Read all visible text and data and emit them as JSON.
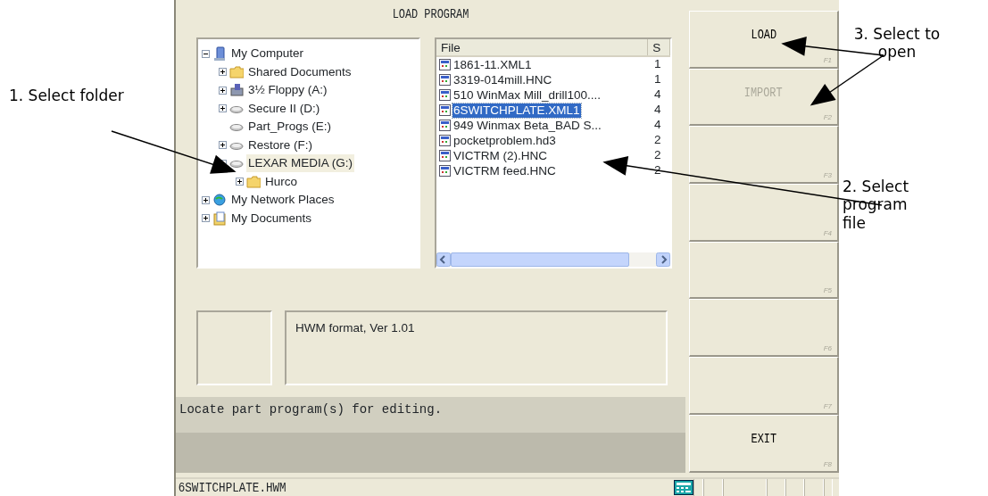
{
  "title": "LOAD PROGRAM",
  "folder_tree": [
    {
      "label": "My Computer",
      "kind": "computer",
      "expanded": true,
      "selected": false,
      "children": [
        {
          "label": "Shared Documents",
          "kind": "folder",
          "expanded": false,
          "selected": false
        },
        {
          "label": "3½ Floppy (A:)",
          "kind": "floppy",
          "expanded": false,
          "selected": false
        },
        {
          "label": "Secure II (D:)",
          "kind": "drive",
          "expanded": false,
          "selected": false
        },
        {
          "label": "Part_Progs (E:)",
          "kind": "drive",
          "selected": false
        },
        {
          "label": "Restore (F:)",
          "kind": "drive",
          "expanded": false,
          "selected": false
        },
        {
          "label": "LEXAR MEDIA (G:)",
          "kind": "drive",
          "expanded": true,
          "selected": true,
          "children": [
            {
              "label": "Hurco",
              "kind": "folder",
              "expanded": false,
              "selected": false
            }
          ]
        }
      ]
    },
    {
      "label": "My Network Places",
      "kind": "network",
      "expanded": false,
      "selected": false
    },
    {
      "label": "My Documents",
      "kind": "documents",
      "expanded": false,
      "selected": false
    }
  ],
  "file_list": {
    "columns": [
      "File",
      "S"
    ],
    "rows": [
      {
        "name": "1861-11.XML1",
        "column_2": "1",
        "selected": false
      },
      {
        "name": "3319-014mill.HNC",
        "column_2": "1",
        "selected": false
      },
      {
        "name": "510 WinMax Mill_drill100....",
        "column_2": "4",
        "selected": false
      },
      {
        "name": "6SWITCHPLATE.XML1",
        "column_2": "4",
        "selected": true
      },
      {
        "name": "949 Winmax Beta_BAD S...",
        "column_2": "4",
        "selected": false
      },
      {
        "name": "pocketproblem.hd3",
        "column_2": "2",
        "selected": false
      },
      {
        "name": "VICTRM (2).HNC",
        "column_2": "2",
        "selected": false
      },
      {
        "name": "VICTRM feed.HNC",
        "column_2": "2",
        "selected": false
      }
    ]
  },
  "info_text": "HWM format, Ver 1.01",
  "message": "Locate part program(s) for editing.",
  "softkeys": [
    {
      "label": "LOAD",
      "key": "F1",
      "disabled": false
    },
    {
      "label": "IMPORT",
      "key": "F2",
      "disabled": true
    },
    {
      "key": "F3"
    },
    {
      "key": "F4"
    },
    {
      "key": "F5"
    },
    {
      "key": "F6"
    },
    {
      "key": "F7"
    },
    {
      "label": "EXIT",
      "key": "F8",
      "disabled": false
    }
  ],
  "status_bar": {
    "filename": "6SWITCHPLATE.HWM"
  },
  "annotations": [
    {
      "text": "1. Select folder"
    },
    {
      "text": "3. Select to open"
    },
    {
      "text": "2. Select program file"
    }
  ]
}
